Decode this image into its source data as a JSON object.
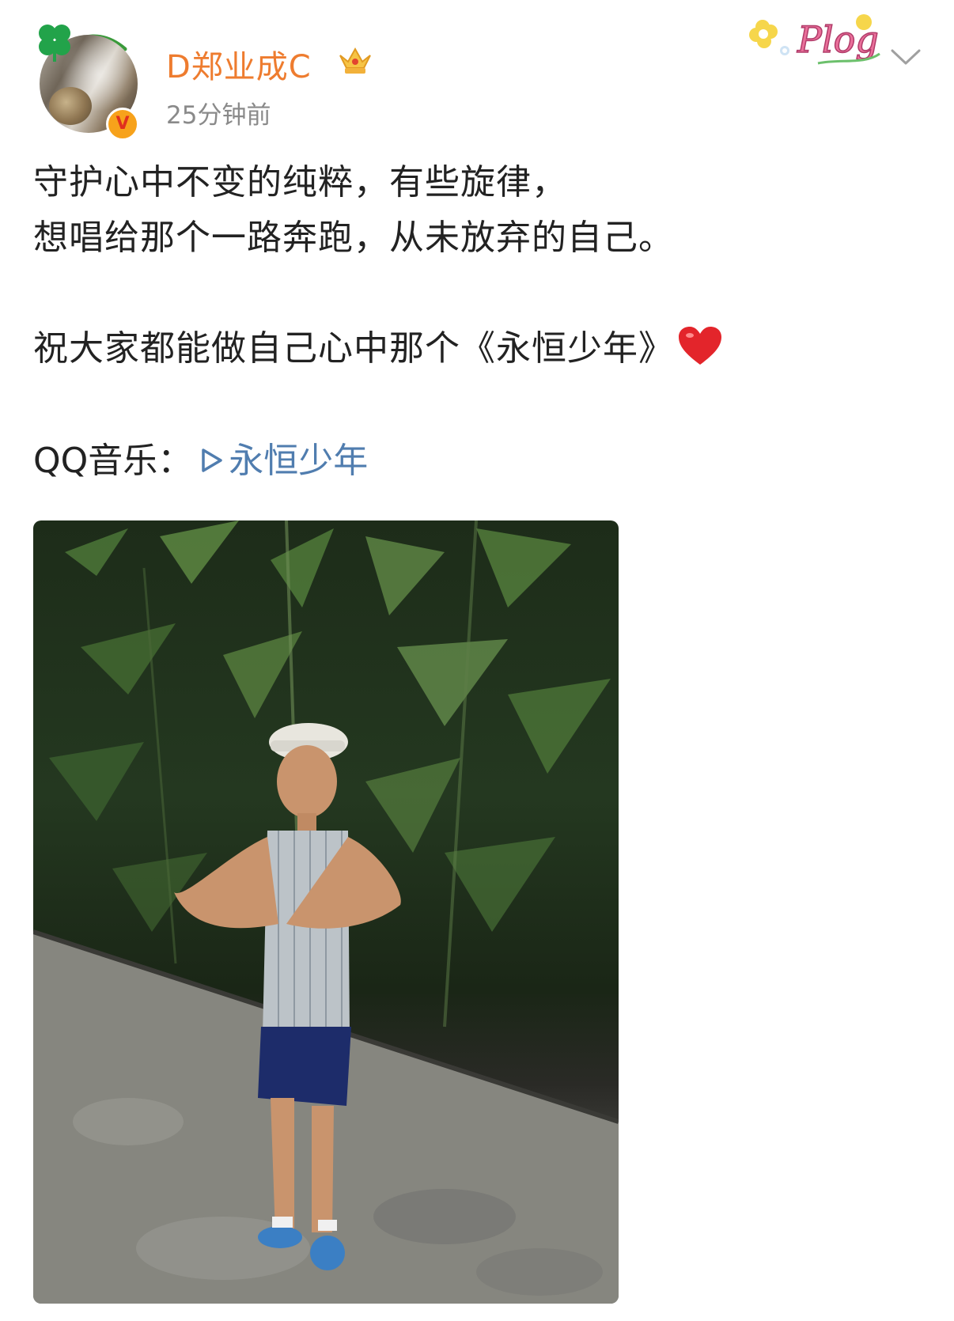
{
  "post": {
    "author": {
      "name": "D郑业成C",
      "badge_letter": "V",
      "time": "25分钟前"
    },
    "text": {
      "line1": "守护心中不变的纯粹，有些旋律，",
      "line2": "想唱给那个一路奔跑，从未放弃的自己。",
      "line3": "祝大家都能做自己心中那个《永恒少年》",
      "music_prefix": "QQ音乐：",
      "music_link": "永恒少年"
    },
    "sticker": {
      "text": "Plog"
    },
    "colors": {
      "username": "#ee7c2f",
      "link": "#507daf",
      "timestamp": "#8a8a8a",
      "body_text": "#222222"
    },
    "icons": [
      "clover-icon",
      "crown-icon",
      "verified-badge-icon",
      "chevron-down-icon",
      "heart-icon",
      "play-icon"
    ]
  }
}
